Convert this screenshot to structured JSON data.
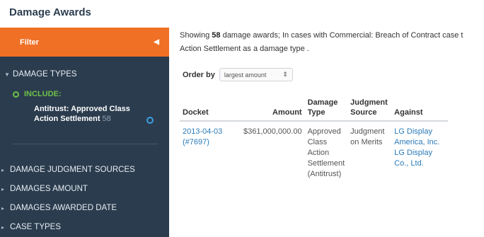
{
  "page": {
    "title": "Damage Awards"
  },
  "sidebar": {
    "filter_label": "Filter",
    "sections": [
      {
        "label": "DAMAGE TYPES"
      },
      {
        "label": "DAMAGE JUDGMENT SOURCES"
      },
      {
        "label": "DAMAGES AMOUNT"
      },
      {
        "label": "DAMAGES AWARDED DATE"
      },
      {
        "label": "CASE TYPES"
      }
    ],
    "include_label": "INCLUDE:",
    "facet": {
      "label": "Antitrust: Approved Class Action Settlement",
      "count": "58"
    }
  },
  "summary": {
    "prefix": "Showing ",
    "count": "58",
    "middle": " damage awards;  In cases with Commercial: Breach of Contract case t",
    "line2": "Action Settlement as a damage type ."
  },
  "order": {
    "label": "Order by",
    "selected": "largest amount"
  },
  "table": {
    "headers": [
      "Docket",
      "Amount",
      "Damage Type",
      "Judgment Source",
      "Against"
    ],
    "rows": [
      {
        "docket": "2013-04-03 (#7697)",
        "amount": "$361,000,000.00",
        "damage_type": "Approved Class Action Settlement (Antitrust)",
        "judgment_source": "Judgment on Merits",
        "against": [
          "LG Display America, Inc.",
          "LG Display Co., Ltd."
        ]
      }
    ]
  },
  "colors": {
    "accent": "#f07026",
    "sidebar": "#2b3c4e",
    "include": "#6ec14a",
    "link": "#2a7ab8"
  },
  "icons": {
    "collapse": "chevron-left-icon",
    "expanded": "caret-down-icon",
    "collapsed": "caret-right-icon",
    "include": "circle-icon",
    "remove": "circle-remove-icon",
    "select": "updown-icon"
  }
}
